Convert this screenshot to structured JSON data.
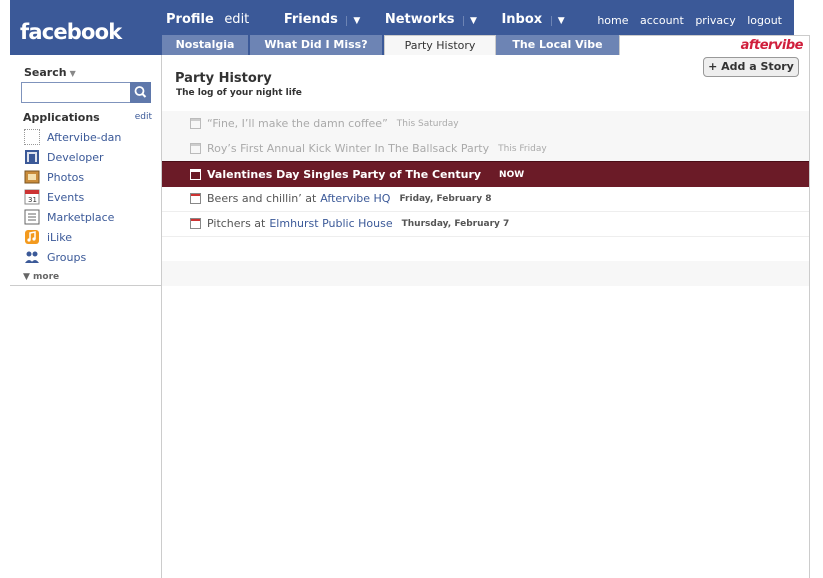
{
  "header": {
    "logo": "facebook",
    "nav": {
      "profile": "Profile",
      "edit": "edit",
      "friends": "Friends",
      "networks": "Networks",
      "inbox": "Inbox",
      "dropdown": "▼"
    },
    "right_links": [
      "home",
      "account",
      "privacy",
      "logout"
    ]
  },
  "tabs": [
    "Nostalgia",
    "What Did I Miss?",
    "Party History",
    "The Local Vibe"
  ],
  "selected_tab": "Party History",
  "brand": "aftervibe",
  "sidebar": {
    "search_label": "Search",
    "search_arrow": "▼",
    "apps_title": "Applications",
    "apps_edit": "edit",
    "apps": [
      {
        "label": "Aftervibe-dan",
        "icon": "dotted-square-icon"
      },
      {
        "label": "Developer",
        "icon": "developer-icon"
      },
      {
        "label": "Photos",
        "icon": "photos-icon"
      },
      {
        "label": "Events",
        "icon": "events-calendar-icon"
      },
      {
        "label": "Marketplace",
        "icon": "marketplace-icon"
      },
      {
        "label": "iLike",
        "icon": "ilike-icon"
      },
      {
        "label": "Groups",
        "icon": "groups-icon"
      }
    ],
    "more": "▼  more"
  },
  "main": {
    "add_story": "+ Add a Story",
    "title": "Party History",
    "subtitle": "The log of your night life",
    "events": [
      {
        "name": "“Fine, I’ll make the damn coffee”",
        "when": "This Saturday",
        "style": "faded"
      },
      {
        "name": "Roy’s First Annual Kick Winter In The Ballsack Party",
        "when": "This Friday",
        "style": "faded"
      },
      {
        "name": "Valentines Day Singles Party of The Century",
        "when": "NOW",
        "style": "now"
      },
      {
        "name": "Beers and chillin’ at",
        "link": "Aftervibe HQ",
        "when": "Friday, February 8",
        "style": "normal"
      },
      {
        "name": "Pitchers at",
        "link": "Elmhurst Public House",
        "when": "Thursday, February 7",
        "style": "normal"
      }
    ]
  }
}
